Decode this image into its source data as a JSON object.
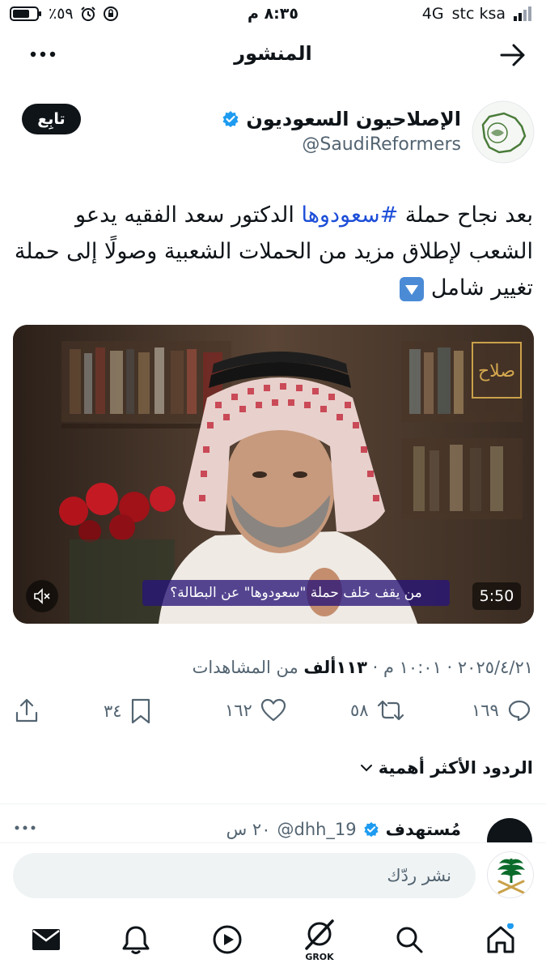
{
  "status_bar": {
    "time": "٨:٣٥ م",
    "network": "4G",
    "carrier": "stc ksa",
    "battery": "٪٥٩"
  },
  "header": {
    "title": "المنشور"
  },
  "author": {
    "name": "الإصلاحيون السعوديون",
    "handle": "@SaudiReformers",
    "follow_label": "تابِع"
  },
  "tweet": {
    "text_part1": "بعد نجاح حملة ",
    "hashtag": "#سعودوها",
    "text_part2": " الدكتور سعد الفقيه يدعو الشعب لإطلاق مزيد من الحملات الشعبية وصولًا إلى حملة تغيير شامل",
    "emoji": "🔽"
  },
  "media": {
    "caption": "من يقف خلف حملة \"سعودوها\" عن البطالة؟",
    "duration": "5:50",
    "watermark": "صلاح"
  },
  "meta": {
    "date_time": "٢٠٢٥/٤/٢١ · ١٠:٠١ م · ",
    "views_count": "١١٣ألف",
    "views_label": " من المشاهدات"
  },
  "actions": {
    "replies": "١٦٩",
    "reposts": "٥٨",
    "likes": "١٦٢",
    "bookmarks": "٣٤"
  },
  "sort": {
    "label": "الردود الأكثر أهمية"
  },
  "reply_preview": {
    "name": "مُستهدف",
    "handle": "@dhh_19",
    "time": "٢٠ س"
  },
  "reply_bar": {
    "placeholder": "نشر ردّك"
  },
  "nav": {
    "grok_label": "GROK"
  },
  "colors": {
    "accent": "#1d9bf0",
    "text": "#0f1419",
    "muted": "#536471",
    "link": "#1d4ed8"
  }
}
